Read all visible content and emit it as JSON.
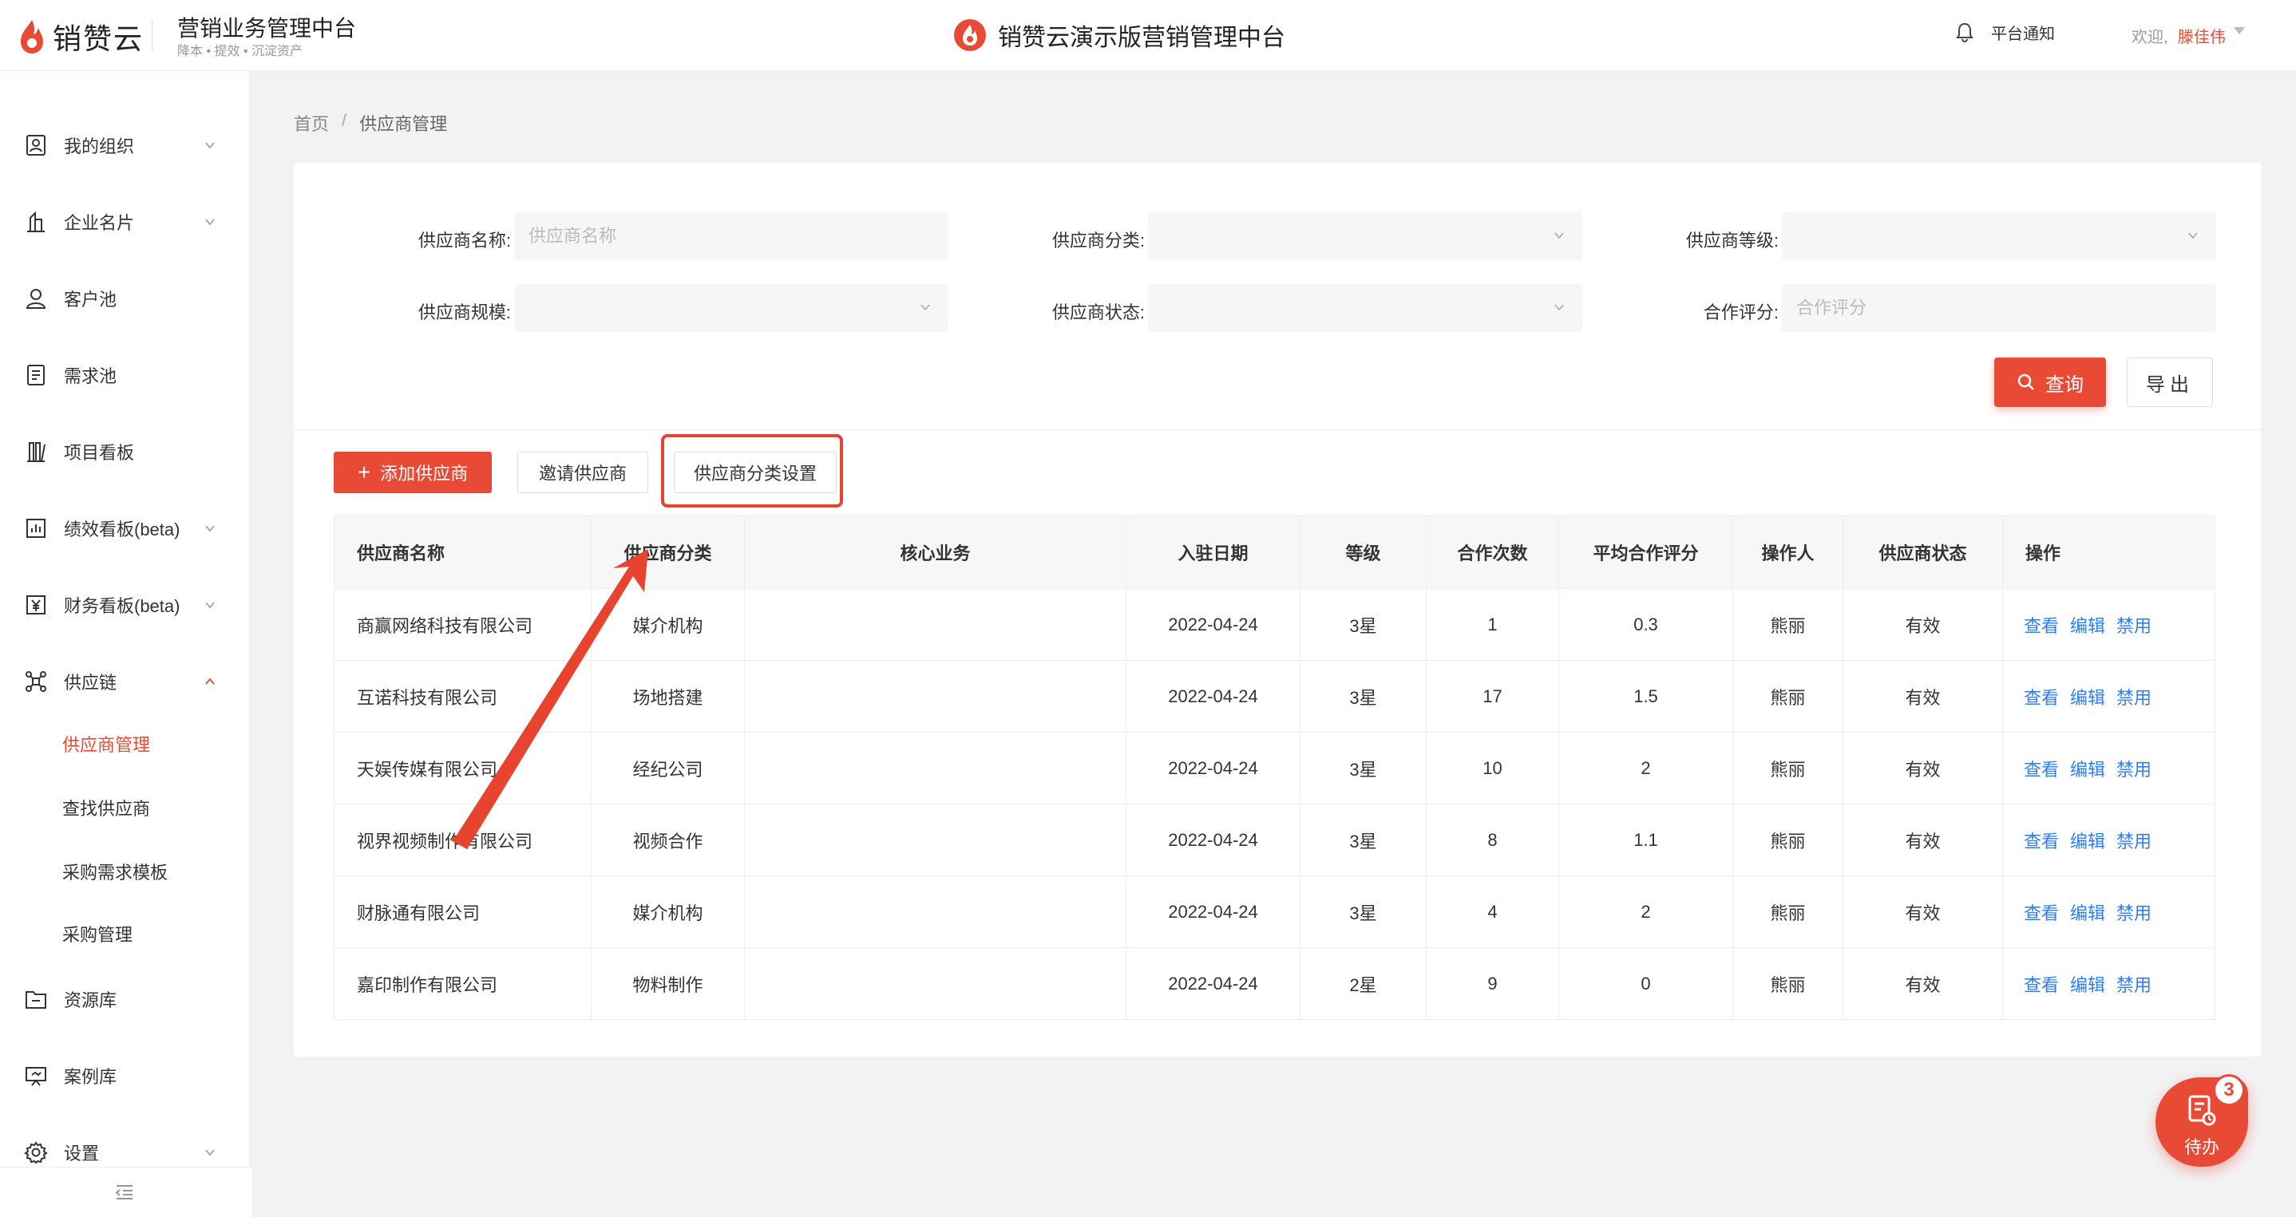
{
  "header": {
    "logo_text": "销赞云",
    "brand_title": "营销业务管理中台",
    "brand_tagline": "降本 • 提效 • 沉淀资产",
    "center_title": "销赞云演示版营销管理中台",
    "notice_label": "平台通知",
    "welcome": "欢迎,",
    "username": "滕佳伟"
  },
  "sidebar": {
    "items": [
      {
        "label": "我的组织",
        "icon": "org-icon",
        "chevron": "down"
      },
      {
        "label": "企业名片",
        "icon": "building-icon",
        "chevron": "down"
      },
      {
        "label": "客户池",
        "icon": "user-icon",
        "chevron": ""
      },
      {
        "label": "需求池",
        "icon": "doc-icon",
        "chevron": ""
      },
      {
        "label": "项目看板",
        "icon": "board-icon",
        "chevron": ""
      },
      {
        "label": "绩效看板(beta)",
        "icon": "chart-icon",
        "chevron": "down"
      },
      {
        "label": "财务看板(beta)",
        "icon": "yen-icon",
        "chevron": "down"
      },
      {
        "label": "供应链",
        "icon": "supply-chain-icon",
        "chevron": "up"
      }
    ],
    "sub_items": [
      {
        "label": "供应商管理",
        "active": true
      },
      {
        "label": "查找供应商",
        "active": false
      },
      {
        "label": "采购需求模板",
        "active": false
      },
      {
        "label": "采购管理",
        "active": false
      }
    ],
    "bottom_items": [
      {
        "label": "资源库",
        "icon": "folder-icon",
        "chevron": ""
      },
      {
        "label": "案例库",
        "icon": "presentation-icon",
        "chevron": ""
      },
      {
        "label": "设置",
        "icon": "gear-icon",
        "chevron": "down"
      }
    ]
  },
  "breadcrumb": {
    "home": "首页",
    "separator": "/",
    "current": "供应商管理"
  },
  "filters": {
    "name_label": "供应商名称:",
    "name_placeholder": "供应商名称",
    "category_label": "供应商分类:",
    "level_label": "供应商等级:",
    "scale_label": "供应商规模:",
    "status_label": "供应商状态:",
    "rating_label": "合作评分:",
    "rating_placeholder": "合作评分",
    "query_button": "查询",
    "export_button": "导出"
  },
  "actions": {
    "add_button": "添加供应商",
    "invite_button": "邀请供应商",
    "category_settings_button": "供应商分类设置"
  },
  "table": {
    "headers": [
      "供应商名称",
      "供应商分类",
      "核心业务",
      "入驻日期",
      "等级",
      "合作次数",
      "平均合作评分",
      "操作人",
      "供应商状态",
      "操作"
    ],
    "rows": [
      {
        "name": "商赢网络科技有限公司",
        "category": "媒介机构",
        "core": "",
        "date": "2022-04-24",
        "level": "3星",
        "count": "1",
        "rating": "0.3",
        "operator": "熊丽",
        "status": "有效"
      },
      {
        "name": "互诺科技有限公司",
        "category": "场地搭建",
        "core": "",
        "date": "2022-04-24",
        "level": "3星",
        "count": "17",
        "rating": "1.5",
        "operator": "熊丽",
        "status": "有效"
      },
      {
        "name": "天娱传媒有限公司",
        "category": "经纪公司",
        "core": "",
        "date": "2022-04-24",
        "level": "3星",
        "count": "10",
        "rating": "2",
        "operator": "熊丽",
        "status": "有效"
      },
      {
        "name": "视界视频制作有限公司",
        "category": "视频合作",
        "core": "",
        "date": "2022-04-24",
        "level": "3星",
        "count": "8",
        "rating": "1.1",
        "operator": "熊丽",
        "status": "有效"
      },
      {
        "name": "财脉通有限公司",
        "category": "媒介机构",
        "core": "",
        "date": "2022-04-24",
        "level": "3星",
        "count": "4",
        "rating": "2",
        "operator": "熊丽",
        "status": "有效"
      },
      {
        "name": "嘉印制作有限公司",
        "category": "物料制作",
        "core": "",
        "date": "2022-04-24",
        "level": "2星",
        "count": "9",
        "rating": "0",
        "operator": "熊丽",
        "status": "有效"
      }
    ],
    "op_view": "查看",
    "op_edit": "编辑",
    "op_disable": "禁用"
  },
  "todo": {
    "label": "待办",
    "badge": "3"
  },
  "colors": {
    "accent": "#e84a36",
    "link": "#2f7ef4",
    "annotation": "#e8432f"
  }
}
